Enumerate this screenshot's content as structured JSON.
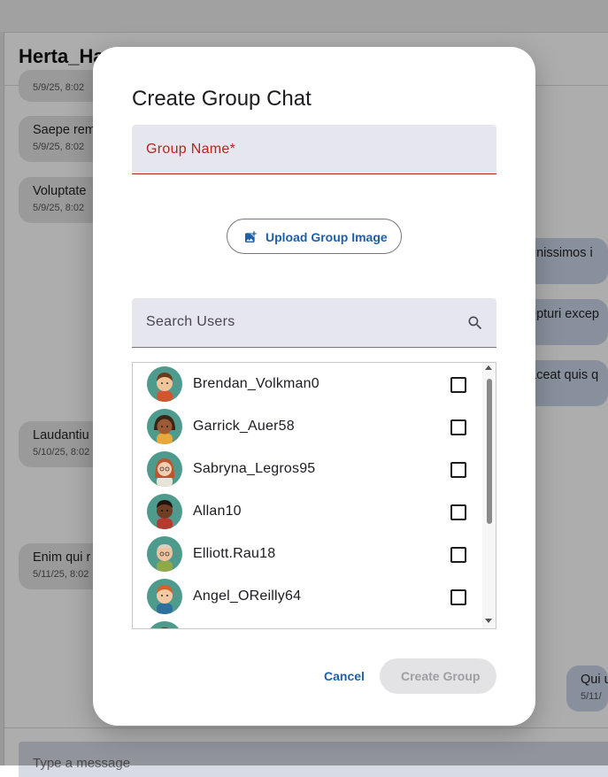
{
  "chat": {
    "title": "Herta_Ha",
    "composer_placeholder": "Type a message",
    "messages": [
      {
        "text": "",
        "date": "5/9/25, 8:02"
      },
      {
        "text": "Saepe rem",
        "date": "5/9/25, 8:02"
      },
      {
        "text": "Voluptate",
        "date": "5/9/25, 8:02"
      },
      {
        "text": "gnissimos i",
        "date": ""
      },
      {
        "text": "epturi excep",
        "date": ""
      },
      {
        "text": "aceat quis q",
        "date": ""
      },
      {
        "text": "Laudantiu",
        "date": "5/10/25, 8:02"
      },
      {
        "text": "Enim qui r",
        "date": "5/11/25, 8:02"
      },
      {
        "text": "Qui u",
        "date": "5/11/"
      }
    ]
  },
  "dialog": {
    "title": "Create Group Chat",
    "group_name_label": "Group Name*",
    "upload_button": "Upload Group Image",
    "search_placeholder": "Search Users",
    "users": [
      {
        "name": "Brendan_Volkman0",
        "checked": false
      },
      {
        "name": "Garrick_Auer58",
        "checked": false
      },
      {
        "name": "Sabryna_Legros95",
        "checked": false
      },
      {
        "name": "Allan10",
        "checked": false
      },
      {
        "name": "Elliott.Rau18",
        "checked": false
      },
      {
        "name": "Angel_OReilly64",
        "checked": false
      }
    ],
    "cancel_button": "Cancel",
    "create_button": "Create Group"
  },
  "colors": {
    "primary": "#1f5fa8",
    "error": "#b3261e",
    "avatar_bg": "#4e9a8c",
    "sent_bubble": "#c7d4e6",
    "received_bubble": "#e4e4e4"
  }
}
